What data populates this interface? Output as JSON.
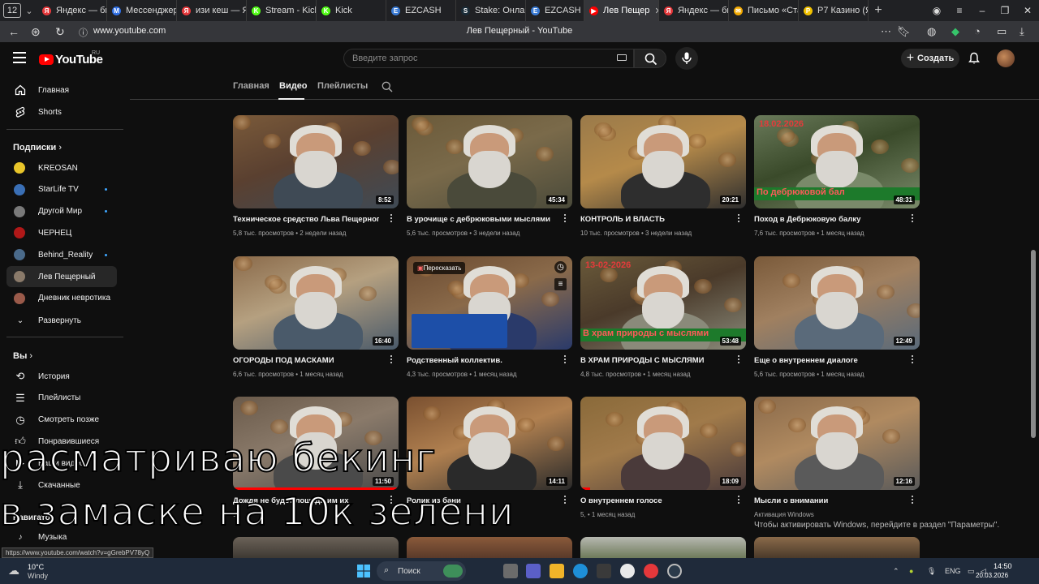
{
  "browser": {
    "tab_count": "12",
    "tabs": [
      {
        "label": "Яндекс — бы",
        "color": "#e5383b",
        "glyph": "Я"
      },
      {
        "label": "Мессенджер",
        "color": "#2f6fe4",
        "glyph": "М"
      },
      {
        "label": "изи кеш — Я",
        "color": "#e5383b",
        "glyph": "Я"
      },
      {
        "label": "Stream - Kick",
        "color": "#53fc18",
        "glyph": "K"
      },
      {
        "label": "Kick",
        "color": "#53fc18",
        "glyph": "K"
      },
      {
        "label": "EZCASH",
        "color": "#3a7bd5",
        "glyph": "E"
      },
      {
        "label": "Stake: Онлай",
        "color": "#1a2c38",
        "glyph": "S"
      },
      {
        "label": "EZCASH",
        "color": "#3a7bd5",
        "glyph": "E"
      },
      {
        "label": "Лев Пещер",
        "color": "#ff0000",
        "glyph": "▶"
      },
      {
        "label": "Яндекс — бы",
        "color": "#e5383b",
        "glyph": "Я"
      },
      {
        "label": "Письмо «Ста",
        "color": "#f2a900",
        "glyph": "✉"
      },
      {
        "label": "P7 Казино (Я",
        "color": "#f2c200",
        "glyph": "P"
      }
    ],
    "url": "www.youtube.com",
    "page_title": "Лев Пещерный - YouTube",
    "status_url": "https://www.youtube.com/watch?v=gGrebPV78yQ"
  },
  "youtube": {
    "logo_text": "YouTube",
    "country_code": "RU",
    "search_placeholder": "Введите запрос",
    "create_label": "Создать"
  },
  "sidebar": {
    "main": [
      {
        "label": "Главная",
        "icon": "home-icon"
      },
      {
        "label": "Shorts",
        "icon": "shorts-icon"
      }
    ],
    "subscriptions_header": "Подписки",
    "subscriptions": [
      {
        "label": "KREOSAN",
        "color": "#e8c52a",
        "dot": false
      },
      {
        "label": "StarLife TV",
        "color": "#3a6fb5",
        "dot": true
      },
      {
        "label": "Другой Мир",
        "color": "#7a7a7a",
        "dot": true
      },
      {
        "label": "ЧЕРНЕЦ",
        "color": "#b01818",
        "dot": false
      },
      {
        "label": "Behind_Reality",
        "color": "#4a6a8a",
        "dot": true
      },
      {
        "label": "Лев Пещерный",
        "color": "#8a7a6a",
        "dot": false
      },
      {
        "label": "Дневник невротика",
        "color": "#9a5a4a",
        "dot": false
      }
    ],
    "expand_label": "Развернуть",
    "you_header": "Вы",
    "you_items": [
      {
        "label": "История",
        "icon": "history-icon"
      },
      {
        "label": "Плейлисты",
        "icon": "playlists-icon"
      },
      {
        "label": "Смотреть позже",
        "icon": "watch-later-icon"
      },
      {
        "label": "Понравившиеся",
        "icon": "like-icon"
      },
      {
        "label": "Ваши видео",
        "icon": "your-videos-icon"
      },
      {
        "label": "Скачанные",
        "icon": "download-icon"
      }
    ],
    "navigator_header": "Навигатор",
    "navigator_items": [
      {
        "label": "Музыка",
        "icon": "music-icon"
      }
    ]
  },
  "channel_tabs": {
    "home": "Главная",
    "videos": "Видео",
    "playlists": "Плейлисты"
  },
  "videos": [
    {
      "title": "Техническое средство Льва Пещерного.",
      "views": "5,8 тыс. просмотров",
      "age": "2 недели назад",
      "duration": "8:52",
      "progress": 0
    },
    {
      "title": "В урочище с дебрюковыми мыслями",
      "views": "5,6 тыс. просмотров",
      "age": "3 недели назад",
      "duration": "45:34",
      "progress": 0
    },
    {
      "title": "КОНТРОЛЬ И ВЛАСТЬ",
      "views": "10 тыс. просмотров",
      "age": "3 недели назад",
      "duration": "20:21",
      "progress": 0
    },
    {
      "title": "Поход в Дебрюковую балку",
      "views": "7,6 тыс. просмотров",
      "age": "1 месяц назад",
      "duration": "48:31",
      "progress": 0,
      "overlay_date": "18.02.2026",
      "overlay_band": "По дебрюковой бал"
    },
    {
      "title": "ОГОРОДЫ ПОД МАСКАМИ",
      "views": "6,6 тыс. просмотров",
      "age": "1 месяц назад",
      "duration": "16:40",
      "progress": 0
    },
    {
      "title": "Родственный коллектив.",
      "views": "4,3 тыс. просмотров",
      "age": "1 месяц назад",
      "duration": "",
      "progress": 0,
      "hover_chip": "Пересказать"
    },
    {
      "title": "В ХРАМ ПРИРОДЫ С МЫСЛЯМИ",
      "views": "4,8 тыс. просмотров",
      "age": "1 месяц назад",
      "duration": "53:48",
      "progress": 0,
      "overlay_date": "13-02-2026",
      "overlay_band": "В храм природы с мыслями"
    },
    {
      "title": "Еще о внутреннем диалоге",
      "views": "5,6 тыс. просмотров",
      "age": "1 месяц назад",
      "duration": "12:49",
      "progress": 0
    },
    {
      "title": "Дождя не будет лошадь им их",
      "views": "9,",
      "age": "",
      "duration": "11:50",
      "progress": 1
    },
    {
      "title": "Ролик из бани",
      "views": "",
      "age": "",
      "duration": "14:11",
      "progress": 0
    },
    {
      "title": "О внутреннем голосе",
      "views": "5,",
      "age": "1 месяц назад",
      "duration": "18:09",
      "progress": 0.06
    },
    {
      "title": "Мысли о внимании",
      "views": "Активация Windows",
      "age": "",
      "duration": "12:16",
      "progress": 0
    }
  ],
  "caption": {
    "line1": "расматриваю бекинг",
    "line2": "в замаске  на 10к зелени"
  },
  "windows_activation": {
    "title": "Активация Windows",
    "body": "Чтобы активировать Windows, перейдите в раздел \"Параметры\"."
  },
  "taskbar": {
    "weather_temp": "10°C",
    "weather_desc": "Windy",
    "search_label": "Поиск",
    "lang": "ENG",
    "time": "14:50",
    "date": "20.03.2026"
  }
}
